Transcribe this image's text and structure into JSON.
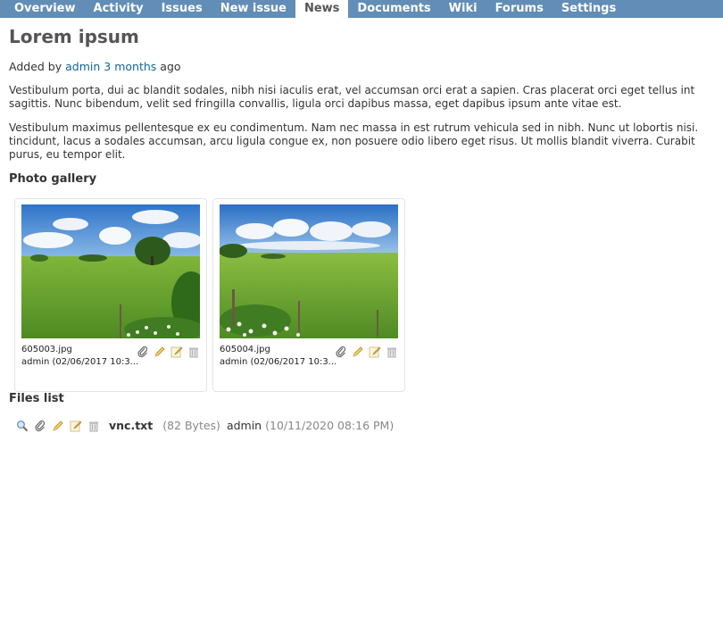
{
  "menu": {
    "items": [
      {
        "label": "Overview"
      },
      {
        "label": "Activity"
      },
      {
        "label": "Issues"
      },
      {
        "label": "New issue"
      },
      {
        "label": "News",
        "selected": true
      },
      {
        "label": "Documents"
      },
      {
        "label": "Wiki"
      },
      {
        "label": "Forums"
      },
      {
        "label": "Settings"
      }
    ],
    "bg_color": "#628db6"
  },
  "news": {
    "title": "Lorem ipsum",
    "added_by_prefix": "Added by",
    "author": "admin",
    "age": "3 months",
    "age_suffix": "ago",
    "paragraphs": [
      "Vestibulum porta, dui ac blandit sodales, nibh nisi iaculis erat, vel accumsan orci erat a sapien. Cras placerat orci eget tellus int",
      "sagittis. Nunc bibendum, velit sed fringilla convallis, ligula orci dapibus massa, eget dapibus ipsum ante vitae est.",
      "Vestibulum maximus pellentesque ex eu condimentum. Nam nec massa in est rutrum vehicula sed in nibh. Nunc ut lobortis nisi.",
      "tincidunt, lacus a sodales accumsan, arcu ligula congue ex, non posuere odio libero eget risus. Ut mollis blandit viverra. Curabit",
      "purus, eu tempor elit."
    ]
  },
  "gallery": {
    "title": "Photo gallery",
    "items": [
      {
        "filename": "605003.jpg",
        "author_line": "admin (02/06/2017 10:3..."
      },
      {
        "filename": "605004.jpg",
        "author_line": "admin (02/06/2017 10:3..."
      }
    ]
  },
  "files": {
    "title": "Files list",
    "items": [
      {
        "filename": "vnc.txt",
        "size": "(82 Bytes)",
        "author": "admin",
        "date": "(10/11/2020 08:16 PM)"
      }
    ]
  },
  "icons": [
    "magnifier-icon",
    "paperclip-icon",
    "pencil-icon",
    "edit-note-icon",
    "trash-icon"
  ]
}
